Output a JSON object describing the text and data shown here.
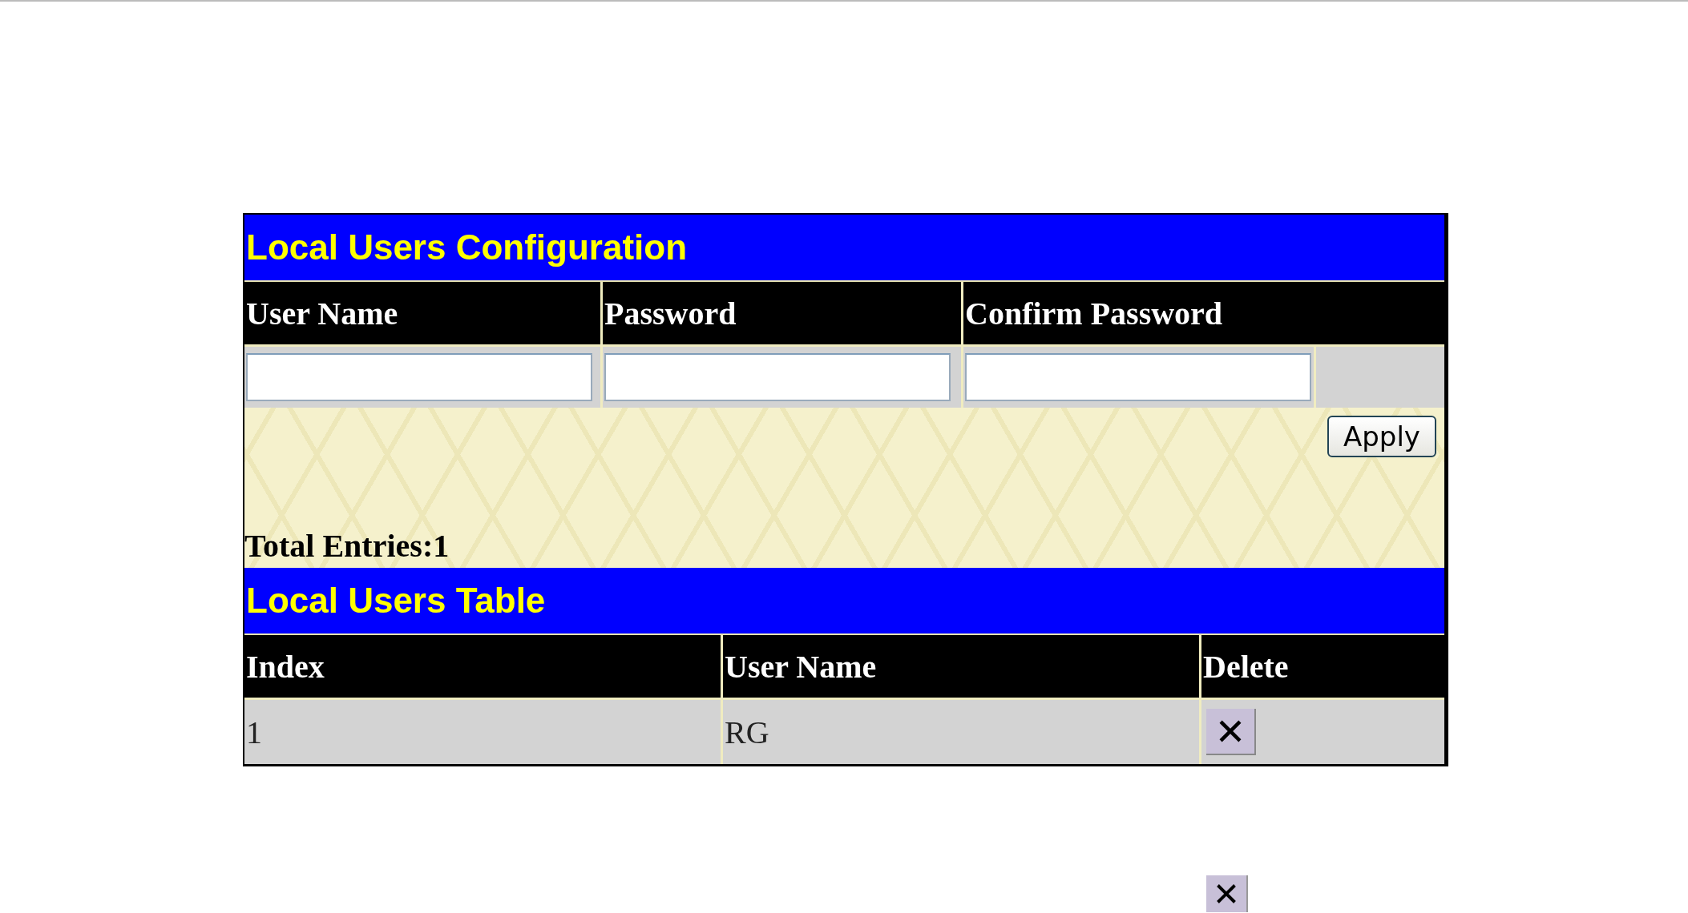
{
  "config": {
    "title": "Local Users Configuration",
    "columns": [
      "User Name",
      "Password",
      "Confirm Password"
    ],
    "apply_button": "Apply",
    "total_entries": "Total Entries:1"
  },
  "table": {
    "title": "Local Users Table",
    "columns": [
      "Index",
      "User Name",
      "Delete"
    ],
    "rows": [
      {
        "index": "1",
        "user_name": "RG"
      }
    ]
  }
}
